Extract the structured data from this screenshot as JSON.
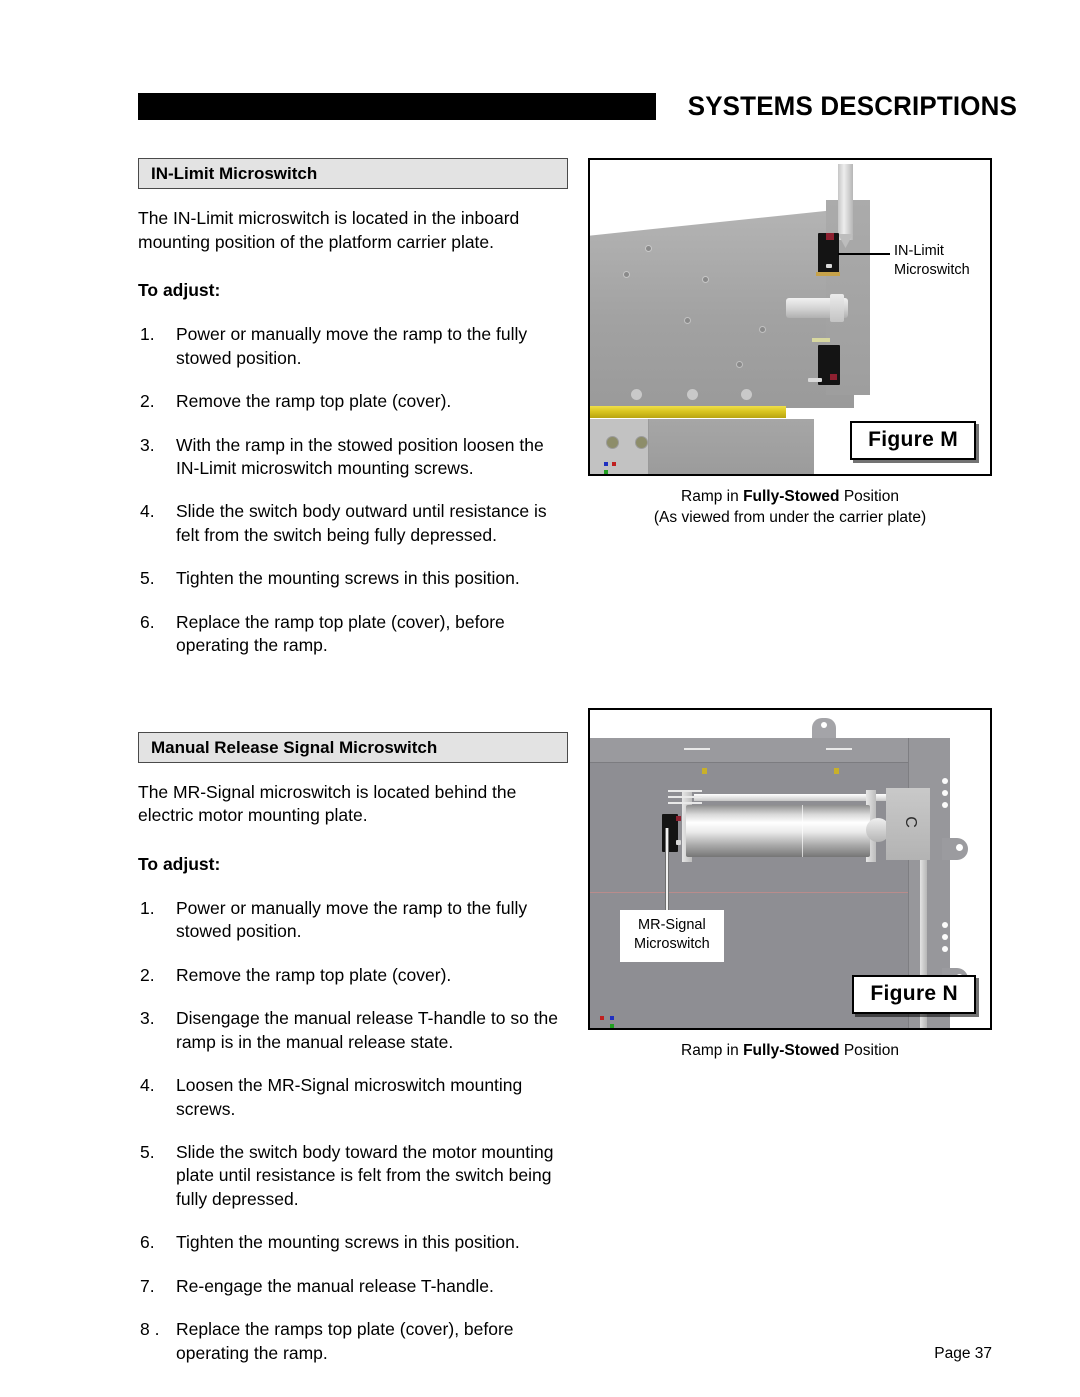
{
  "header": {
    "title": "SYSTEMS DESCRIPTIONS"
  },
  "sections": [
    {
      "heading": "IN-Limit Microswitch",
      "intro": "The IN-Limit microswitch is located in the inboard mounting position of the platform carrier plate.",
      "to_adjust_label": "To adjust:",
      "steps": [
        {
          "num": "1.",
          "text": "Power or manually move the ramp to the fully stowed position."
        },
        {
          "num": "2.",
          "text": "Remove the ramp top plate (cover)."
        },
        {
          "num": "3.",
          "text": "With the ramp in the stowed position loosen the IN-Limit microswitch mounting screws."
        },
        {
          "num": "4.",
          "text": "Slide the switch body outward until resistance is felt from the switch being fully depressed."
        },
        {
          "num": "5.",
          "text": "Tighten the mounting screws in this position."
        },
        {
          "num": "6.",
          "text": "Replace the ramp top plate (cover), before operating the ramp."
        }
      ]
    },
    {
      "heading": "Manual Release Signal Microswitch",
      "intro": "The MR-Signal microswitch is located behind the electric motor mounting plate.",
      "to_adjust_label": "To adjust:",
      "steps": [
        {
          "num": "1.",
          "text": "Power or manually move the ramp to the fully stowed position."
        },
        {
          "num": "2.",
          "text": "Remove the ramp top plate (cover)."
        },
        {
          "num": "3.",
          "text": "Disengage the manual release T-handle to so the ramp is in the manual release state."
        },
        {
          "num": "4.",
          "text": "Loosen the MR-Signal microswitch mounting screws."
        },
        {
          "num": "5.",
          "text": "Slide the switch body toward the motor mounting plate until resistance is felt from the switch being fully depressed."
        },
        {
          "num": "6.",
          "text": "Tighten the mounting screws in this position."
        },
        {
          "num": "7.",
          "text": "Re-engage the manual release T-handle."
        },
        {
          "num": "8 .",
          "text": "Replace the ramps top plate (cover), before operating the ramp."
        }
      ]
    }
  ],
  "figures": [
    {
      "tag": "Figure M",
      "callout_line1": "IN-Limit",
      "callout_line2": "Microswitch",
      "caption_prefix": "Ramp in ",
      "caption_bold": "Fully-Stowed",
      "caption_suffix": " Position",
      "caption_line2": "(As viewed from under the carrier plate)"
    },
    {
      "tag": "Figure N",
      "callout_line1": "MR-Signal",
      "callout_line2": "Microswitch",
      "caption_prefix": "Ramp in ",
      "caption_bold": "Fully-Stowed",
      "caption_suffix": " Position",
      "caption_line2": ""
    }
  ],
  "footer": {
    "page": "Page 37"
  },
  "colors": {
    "heading_fill": "#e3e3e3",
    "header_bar": "#000000",
    "yellow_strip": "#d9c520",
    "plate_gray": "#9a9a9a",
    "backplate_gray": "#8e8e93"
  }
}
